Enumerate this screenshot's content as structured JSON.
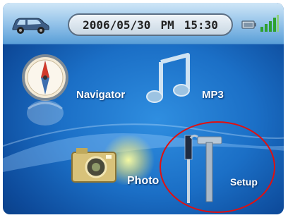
{
  "status_bar": {
    "date": "2006/05/30",
    "period": "PM",
    "time": "15:30"
  },
  "menu": [
    {
      "label": "Navigator",
      "icon": "compass-icon"
    },
    {
      "label": "MP3",
      "icon": "music-note-icon"
    },
    {
      "label": "Photo",
      "icon": "camera-icon"
    },
    {
      "label": "Setup",
      "icon": "tools-icon"
    }
  ],
  "highlight_color": "#e01010"
}
